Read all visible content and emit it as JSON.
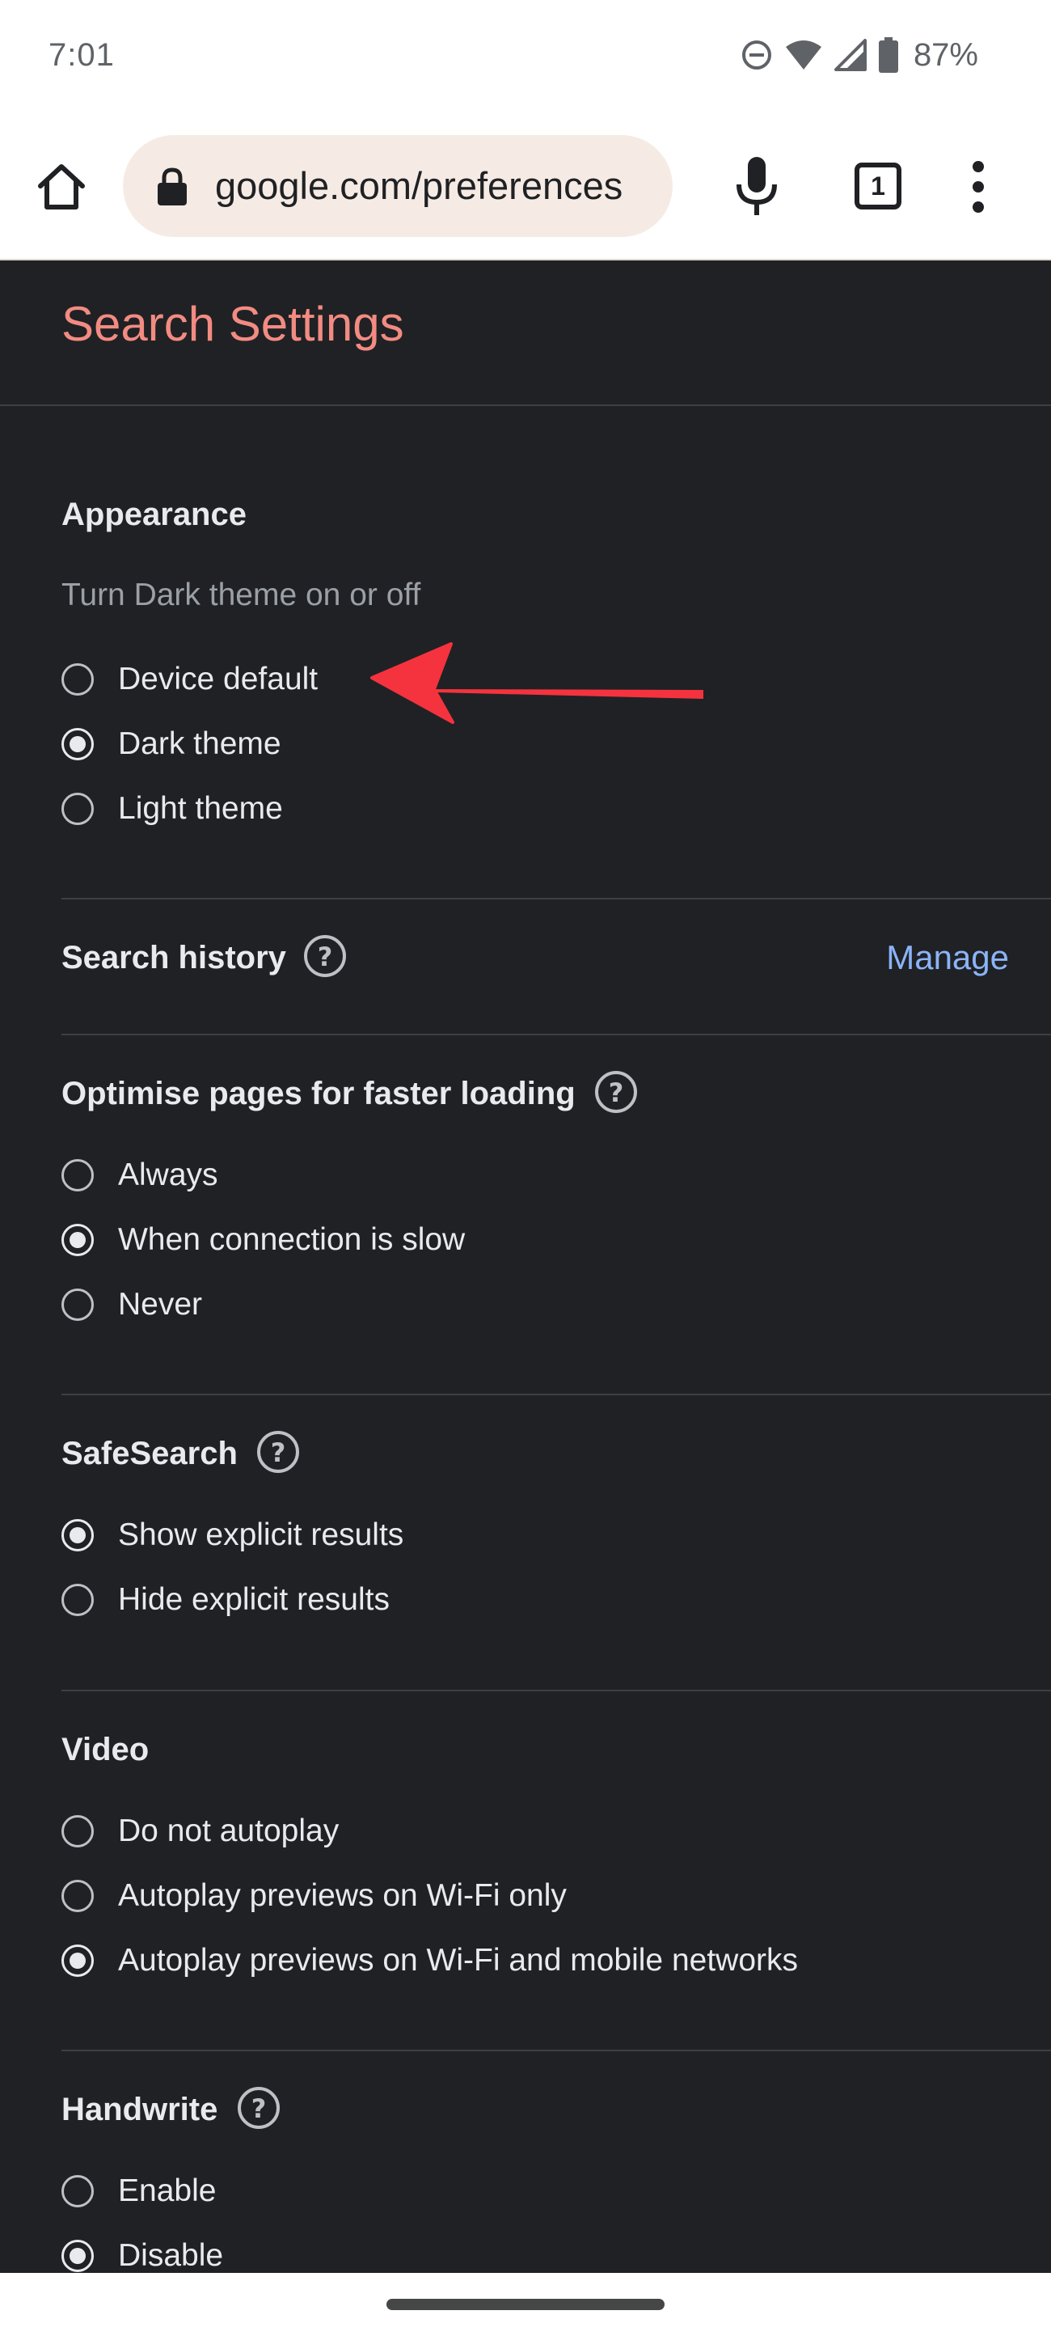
{
  "status_bar": {
    "time": "7:01",
    "battery": "87%",
    "icons": [
      "do-not-disturb-icon",
      "wifi-icon",
      "cell-signal-icon",
      "battery-icon"
    ]
  },
  "toolbar": {
    "url": "google.com/preferences",
    "tab_count": "1",
    "icons": [
      "home-icon",
      "lock-icon",
      "mic-icon",
      "tabs-icon",
      "more-vert-icon"
    ]
  },
  "page": {
    "title": "Search Settings"
  },
  "appearance": {
    "title": "Appearance",
    "subtitle": "Turn Dark theme on or off",
    "options": [
      "Device default",
      "Dark theme",
      "Light theme"
    ],
    "selected": "Dark theme"
  },
  "search_history": {
    "title": "Search history",
    "manage_label": "Manage"
  },
  "optimise": {
    "title": "Optimise pages for faster loading",
    "options": [
      "Always",
      "When connection is slow",
      "Never"
    ],
    "selected": "When connection is slow"
  },
  "safesearch": {
    "title": "SafeSearch",
    "options": [
      "Show explicit results",
      "Hide explicit results"
    ],
    "selected": "Show explicit results"
  },
  "video": {
    "title": "Video",
    "options": [
      "Do not autoplay",
      "Autoplay previews on Wi-Fi only",
      "Autoplay previews on Wi-Fi and mobile networks"
    ],
    "selected": "Autoplay previews on Wi-Fi and mobile networks"
  },
  "handwrite": {
    "title": "Handwrite",
    "options": [
      "Enable",
      "Disable"
    ],
    "selected": "Disable"
  },
  "colors": {
    "background": "#202124",
    "title_accent": "#f28b82",
    "link": "#8ab4f8",
    "annotation_arrow": "#f4333e"
  }
}
